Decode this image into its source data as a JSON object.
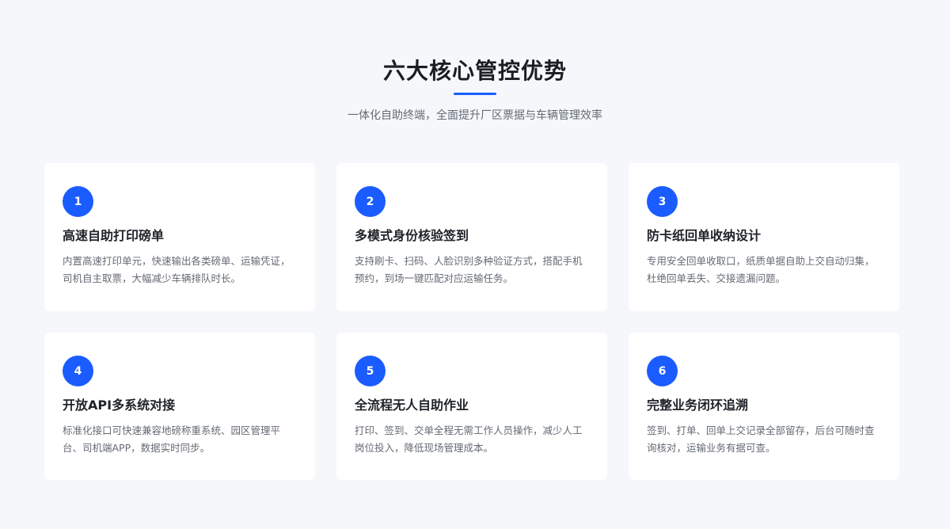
{
  "header": {
    "title": "六大核心管控优势",
    "subtitle": "一体化自助终端，全面提升厂区票据与车辆管理效率"
  },
  "accent_color": "#1a5cff",
  "cards": [
    {
      "number": "1",
      "title": "高速自助打印磅单",
      "description": "内置高速打印单元，快速输出各类磅单、运输凭证，司机自主取票，大幅减少车辆排队时长。"
    },
    {
      "number": "2",
      "title": "多模式身份核验签到",
      "description": "支持刷卡、扫码、人脸识别多种验证方式，搭配手机预约，到场一键匹配对应运输任务。"
    },
    {
      "number": "3",
      "title": "防卡纸回单收纳设计",
      "description": "专用安全回单收取口，纸质单据自助上交自动归集，杜绝回单丢失、交接遗漏问题。"
    },
    {
      "number": "4",
      "title": "开放API多系统对接",
      "description": "标准化接口可快速兼容地磅称重系统、园区管理平台、司机端APP，数据实时同步。"
    },
    {
      "number": "5",
      "title": "全流程无人自助作业",
      "description": "打印、签到、交单全程无需工作人员操作，减少人工岗位投入，降低现场管理成本。"
    },
    {
      "number": "6",
      "title": "完整业务闭环追溯",
      "description": "签到、打单、回单上交记录全部留存，后台可随时查询核对，运输业务有据可查。"
    }
  ]
}
